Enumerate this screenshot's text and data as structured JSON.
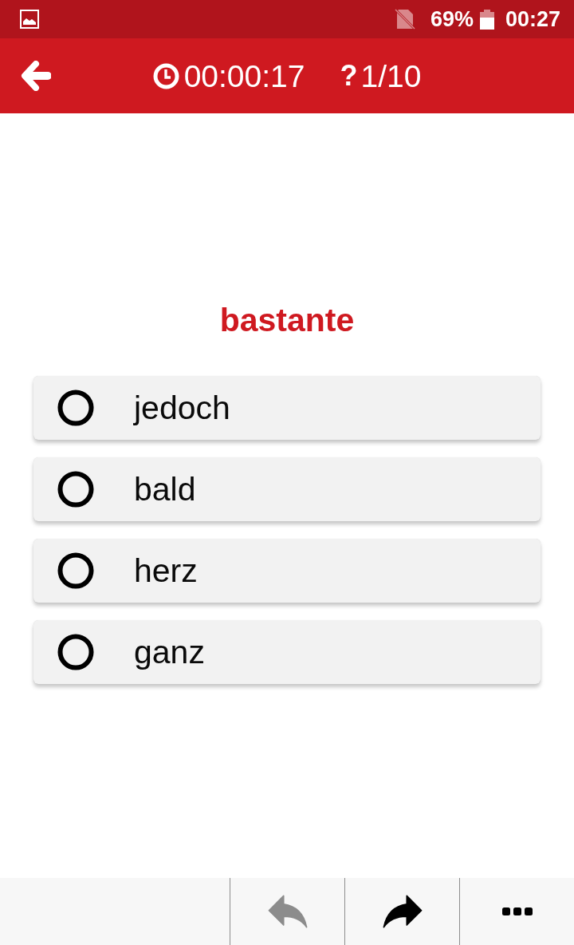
{
  "status_bar": {
    "battery": "69%",
    "time": "00:27"
  },
  "app_bar": {
    "timer": "00:00:17",
    "question_mark": "?",
    "question_count": "1/10"
  },
  "quiz": {
    "word": "bastante",
    "options": [
      {
        "label": "jedoch",
        "selected": false
      },
      {
        "label": "bald",
        "selected": false
      },
      {
        "label": "herz",
        "selected": false
      },
      {
        "label": "ganz",
        "selected": false
      }
    ]
  },
  "toolbar": {
    "buttons": [
      {
        "kind": "undo",
        "disabled": true
      },
      {
        "kind": "redo",
        "disabled": false
      },
      {
        "kind": "more",
        "disabled": false
      }
    ]
  }
}
